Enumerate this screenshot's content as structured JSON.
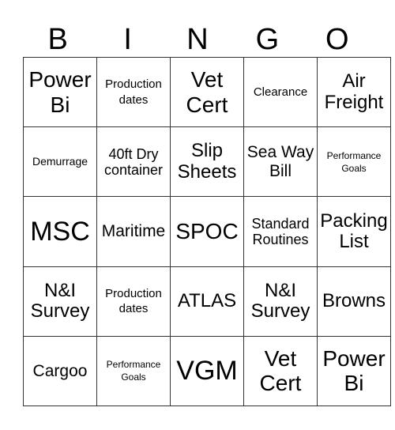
{
  "header": [
    "B",
    "I",
    "N",
    "G",
    "O"
  ],
  "rows": [
    [
      {
        "text": "Power Bi",
        "size": "l"
      },
      {
        "text": "Production dates",
        "size": "s"
      },
      {
        "text": "Vet Cert",
        "size": "xl-2"
      },
      {
        "text": "Clearance",
        "size": "s"
      },
      {
        "text": "Air Freight",
        "size": "m"
      }
    ],
    [
      {
        "text": "Demurrage",
        "size": "xs"
      },
      {
        "text": "40ft Dry container",
        "size": "sm"
      },
      {
        "text": "Slip Sheets",
        "size": "m"
      },
      {
        "text": "Sea Way Bill",
        "size": "ml"
      },
      {
        "text": "Performance Goals",
        "size": "xxs"
      }
    ],
    [
      {
        "text": "MSC",
        "size": "xl"
      },
      {
        "text": "Maritime",
        "size": "ml"
      },
      {
        "text": "SPOC",
        "size": "l"
      },
      {
        "text": "Standard Routines",
        "size": "sm"
      },
      {
        "text": "Packing List",
        "size": "m"
      }
    ],
    [
      {
        "text": "N&I Survey",
        "size": "m"
      },
      {
        "text": "Production dates",
        "size": "s"
      },
      {
        "text": "ATLAS",
        "size": "m"
      },
      {
        "text": "N&I Survey",
        "size": "m"
      },
      {
        "text": "Browns",
        "size": "m"
      }
    ],
    [
      {
        "text": "Cargoo",
        "size": "ml"
      },
      {
        "text": "Performance Goals",
        "size": "xxs"
      },
      {
        "text": "VGM",
        "size": "xl"
      },
      {
        "text": "Vet Cert",
        "size": "xl-2"
      },
      {
        "text": "Power Bi",
        "size": "l"
      }
    ]
  ]
}
